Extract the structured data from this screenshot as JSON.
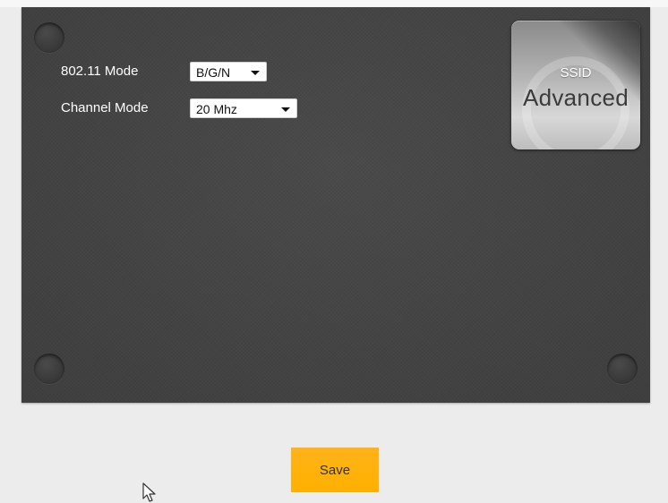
{
  "form": {
    "mode_80211": {
      "label": "802.11 Mode",
      "selected": "B/G/N"
    },
    "channel_mode": {
      "label": "Channel Mode",
      "selected": "20 Mhz"
    }
  },
  "badge": {
    "title": "SSID",
    "subtitle": "Advanced"
  },
  "actions": {
    "save_label": "Save"
  },
  "colors": {
    "panel": "#444444",
    "page_background": "#ececec",
    "save_button": "#ffb000"
  },
  "icons": {
    "cursor": "mouse-pointer-icon",
    "dropdown": "caret-down-icon"
  }
}
